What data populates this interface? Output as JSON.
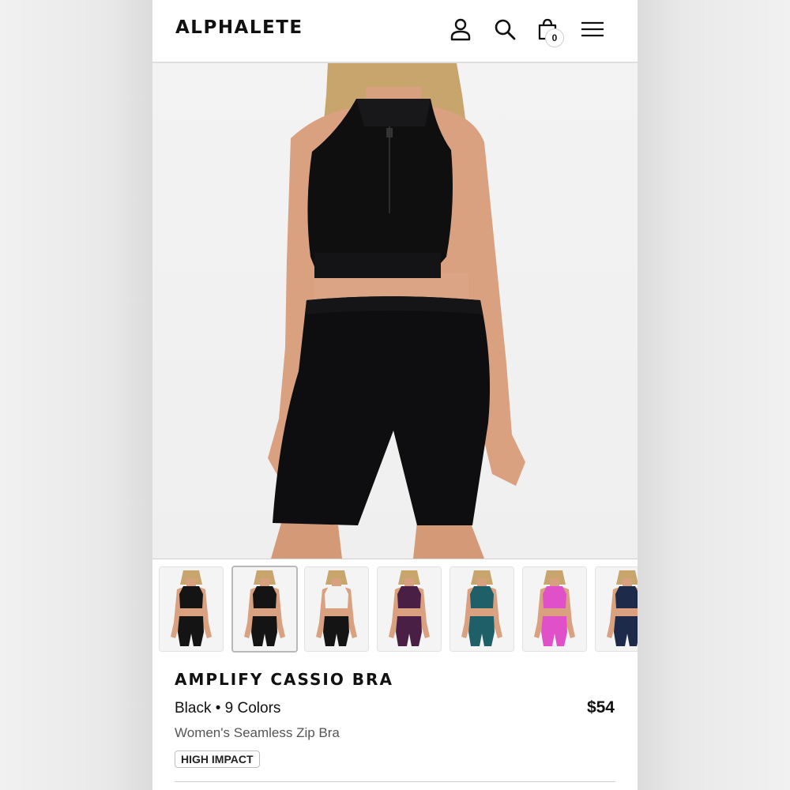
{
  "header": {
    "logo": "ALPHALETE",
    "cart_count": "0",
    "icons": [
      "account-icon",
      "search-icon",
      "shopping-bag-icon",
      "hamburger-menu-icon"
    ]
  },
  "product": {
    "title": "AMPLIFY CASSIO BRA",
    "color_line": "Black • 9 Colors",
    "price": "$54",
    "subtitle": "Women's Seamless Zip Bra",
    "tag": "HIGH IMPACT"
  },
  "thumbnails": [
    {
      "color": "Black",
      "top": "#141414",
      "bottom": "#141414",
      "selected": false
    },
    {
      "color": "Black",
      "top": "#141414",
      "bottom": "#141414",
      "selected": true
    },
    {
      "color": "White",
      "top": "#f2f2f2",
      "bottom": "#141414",
      "selected": false
    },
    {
      "color": "Plum",
      "top": "#4a1f45",
      "bottom": "#4a1f45",
      "selected": false
    },
    {
      "color": "Teal",
      "top": "#1f5f68",
      "bottom": "#1f5f68",
      "selected": false
    },
    {
      "color": "Pink",
      "top": "#e050c8",
      "bottom": "#e050c8",
      "selected": false
    },
    {
      "color": "Navy",
      "top": "#1e2a4a",
      "bottom": "#1e2a4a",
      "selected": false
    }
  ],
  "colors": {
    "text": "#111111",
    "muted": "#555555",
    "skin": "#d9a17f",
    "garment": "#0f0f10",
    "hair": "#c9a46a"
  }
}
